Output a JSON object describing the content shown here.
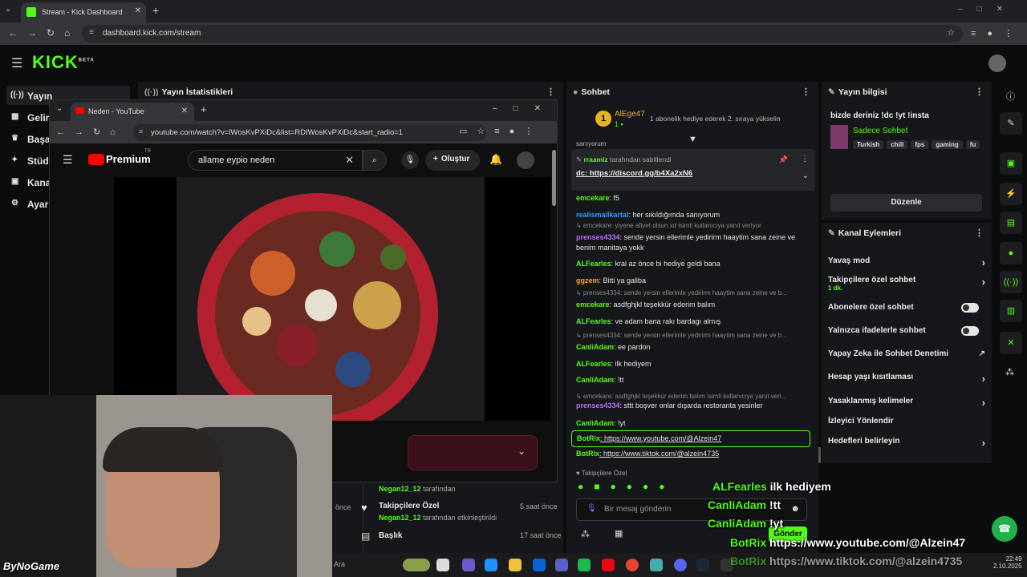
{
  "browser": {
    "tab_title": "Stream - Kick Dashboard",
    "url": "dashboard.kick.com/stream"
  },
  "kick": {
    "logo": "KICK",
    "beta": "BETA"
  },
  "sidebar": {
    "items": [
      {
        "label": "Yayın",
        "icon": "broadcast-icon"
      },
      {
        "label": "Gelir",
        "icon": "income-icon"
      },
      {
        "label": "Başa",
        "icon": "trophy-icon"
      },
      {
        "label": "Stüdy",
        "icon": "studio-icon"
      },
      {
        "label": "Kana",
        "icon": "channel-icon"
      },
      {
        "label": "Ayarl",
        "icon": "gear-icon"
      }
    ]
  },
  "stats": {
    "title": "Yayın İstatistikleri",
    "events": [
      {
        "user": "Negan12_12",
        "text": "tarafından",
        "time": ""
      },
      {
        "title": "Takipçilere Özel",
        "user": "Negan12_12",
        "text": "tarafından etkinleştirildi",
        "time": "5 saat önce"
      },
      {
        "title": "Başlık",
        "user": "",
        "text": "",
        "time": "17 saat önce"
      }
    ],
    "partial_time": "önce"
  },
  "youtube": {
    "tab_title": "Neden - YouTube",
    "url": "youtube.com/watch?v=lWosKvPXiDc&list=RDIWosKvPXiDc&start_radio=1",
    "brand": "Premium",
    "region": "TR",
    "search_query": "allame eypio neden",
    "create_label": "Oluştur"
  },
  "chat": {
    "title": "Sohbet",
    "gift": {
      "user": "AlEge47",
      "count": "1",
      "text": "1 abonelik hediye ederek 2. sıraya yükselin"
    },
    "top_partial": "sanıyorum",
    "pinned": {
      "user": "rraamiz",
      "by": "tarafından sabitlendi",
      "text": "dc: https://discord.gg/b4Xa2xN6"
    },
    "messages": [
      {
        "user": "emcekare",
        "text": "f5",
        "color": "#53fc18"
      },
      {
        "user": "realismailkartal",
        "text": "her sıkıldığımda sanıyorum",
        "color": "#2f9bff"
      },
      {
        "reply": "emcekare: yiyene afiyet olsun xd isimli kullanıcıya yanıt veriyor"
      },
      {
        "user": "prenses4334",
        "text": "sende yersin ellerimle yedirirm haaytim sana zeine ve benim manitaya yokk",
        "color": "#b86cff"
      },
      {
        "user": "ALFearles",
        "text": "kral az önce bi hediye geldi bana",
        "color": "#53fc18"
      },
      {
        "user": "ggzem",
        "text": "Bitti ya galiba",
        "color": "#f5a623"
      },
      {
        "reply": "prenses4334: sende yersin ellerimle yedirirm haaytim sana zeine ve b..."
      },
      {
        "user": "emcekare",
        "text": "asdfghjkl teşekkür ederim balım",
        "color": "#53fc18"
      },
      {
        "user": "ALFearles",
        "text": "ve adam bana rakı bardagı almış",
        "color": "#53fc18"
      },
      {
        "reply": "prenses4334: sende yersin ellerimle yedirirm haaytim sana zeine ve b..."
      },
      {
        "user": "CanliAdam",
        "text": "ee pardon",
        "color": "#53fc18"
      },
      {
        "user": "ALFearles",
        "text": "ilk hediyem",
        "color": "#53fc18"
      },
      {
        "user": "CanliAdam",
        "text": "!tt",
        "color": "#53fc18"
      },
      {
        "reply": "emcekare: asdfghjkl teşekkür ederim balım isimli kullanıcıya yanıt veri..."
      },
      {
        "user": "prenses4334",
        "text": "sttt boşver onlar dışarda restoranta yesinler",
        "color": "#b86cff"
      },
      {
        "user": "CanliAdam",
        "text": "!yt",
        "color": "#53fc18"
      },
      {
        "user": "BotRix",
        "text": "https://www.youtube.com/@Alzein47",
        "color": "#53fc18"
      },
      {
        "user": "BotRix",
        "text": "https://www.tiktok.com/@alzein4735",
        "color": "#53fc18"
      }
    ],
    "mode": "Takipçilere Özel",
    "input_placeholder": "Bir mesaj gönderin",
    "send_label": "Gönder"
  },
  "info": {
    "title": "Yayın bilgisi",
    "stream_title": "bizde deriniz !dc !yt !insta",
    "category": "Sadece Sohbet",
    "tags": [
      "Turkish",
      "chill",
      "fps",
      "gaming",
      "fu"
    ],
    "edit_label": "Düzenle"
  },
  "actions": {
    "title": "Kanal Eylemleri",
    "items": [
      {
        "label": "Yavaş mod",
        "type": "arrow"
      },
      {
        "label": "Takipçilere özel sohbet",
        "sub": "1 dk.",
        "type": "arrow"
      },
      {
        "label": "Abonelere özel sohbet",
        "type": "toggle"
      },
      {
        "label": "Yalnızca ifadelerle sohbet",
        "type": "toggle"
      },
      {
        "label": "Yapay Zeka ile Sohbet Denetimi",
        "type": "external"
      },
      {
        "label": "Hesap yaşı kısıtlaması",
        "type": "arrow"
      },
      {
        "label": "Yasaklanmış kelimeler",
        "type": "arrow"
      },
      {
        "label": "İzleyici Yönlendir",
        "type": "none"
      },
      {
        "label": "Hedefleri belirleyin",
        "type": "arrow"
      }
    ]
  },
  "overlay": {
    "lines": [
      {
        "user": "ALFearles",
        "text": "ilk hediyem"
      },
      {
        "user": "CanliAdam",
        "text": "!tt"
      },
      {
        "user": "CanliAdam",
        "text": "!yt"
      },
      {
        "user": "BotRix",
        "text": "https://www.youtube.com/@Alzein47"
      },
      {
        "user": "BotRix",
        "text": "https://www.tiktok.com/@alzein4735"
      }
    ],
    "watermark": "ByNoGame"
  },
  "taskbar": {
    "search": "Ara",
    "time": "22:49",
    "date": "2.10.2025"
  },
  "colors": {
    "kick_green": "#53fc18",
    "panel": "#16171a",
    "bg": "#0b0c0d"
  }
}
